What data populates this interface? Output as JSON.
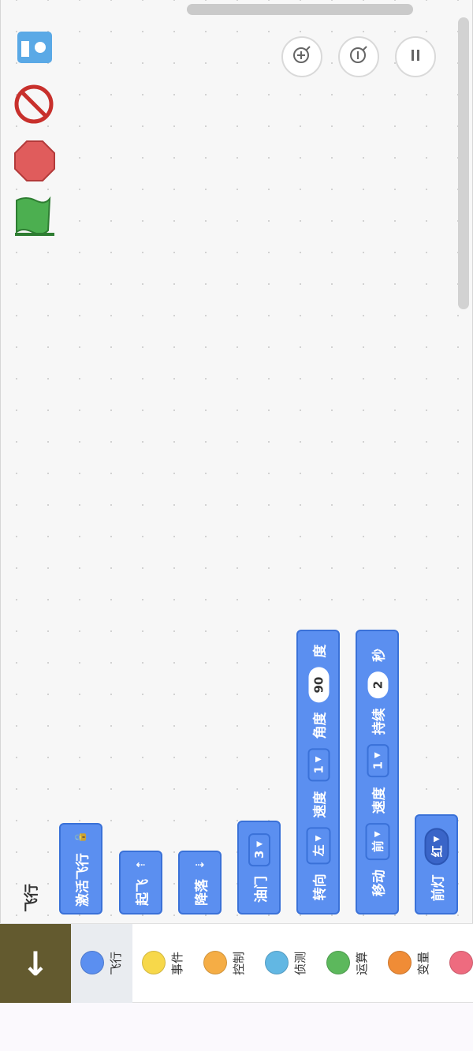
{
  "toolbar": {
    "zoom_in_icon": "zoom-in-icon",
    "zoom_out_icon": "zoom-out-icon",
    "pause_icon": "pause-icon"
  },
  "left_icons": [
    "device-card-icon",
    "prohibit-icon",
    "stop-icon",
    "flag-icon"
  ],
  "category_title": "飞行",
  "blocks": {
    "activate": {
      "label": "激活飞行"
    },
    "takeoff": {
      "label": "起飞"
    },
    "land": {
      "label": "降落"
    },
    "throttle": {
      "label": "油门",
      "value": "3"
    },
    "turn": {
      "label": "转向",
      "direction": "左",
      "speed_label": "速度",
      "speed": "1",
      "angle_label": "角度",
      "angle": "90",
      "unit": "度"
    },
    "move": {
      "label": "移动",
      "direction": "前",
      "speed_label": "速度",
      "speed": "1",
      "duration_label": "持续",
      "duration": "2",
      "unit": "秒"
    },
    "headlight": {
      "label": "前灯",
      "color": "红"
    }
  },
  "categories": [
    {
      "label": "飞行",
      "color": "#5b8ff0"
    },
    {
      "label": "事件",
      "color": "#f7d84a"
    },
    {
      "label": "控制",
      "color": "#f5ad45"
    },
    {
      "label": "侦测",
      "color": "#62b7e3"
    },
    {
      "label": "运算",
      "color": "#5cb85c"
    },
    {
      "label": "变量",
      "color": "#f08c36"
    },
    {
      "label": "",
      "color": "#ee6b7f"
    }
  ],
  "colors": {
    "block_fill": "#5b8ff0",
    "block_border": "#3a71d8",
    "collapse_button": "#635a2f"
  }
}
